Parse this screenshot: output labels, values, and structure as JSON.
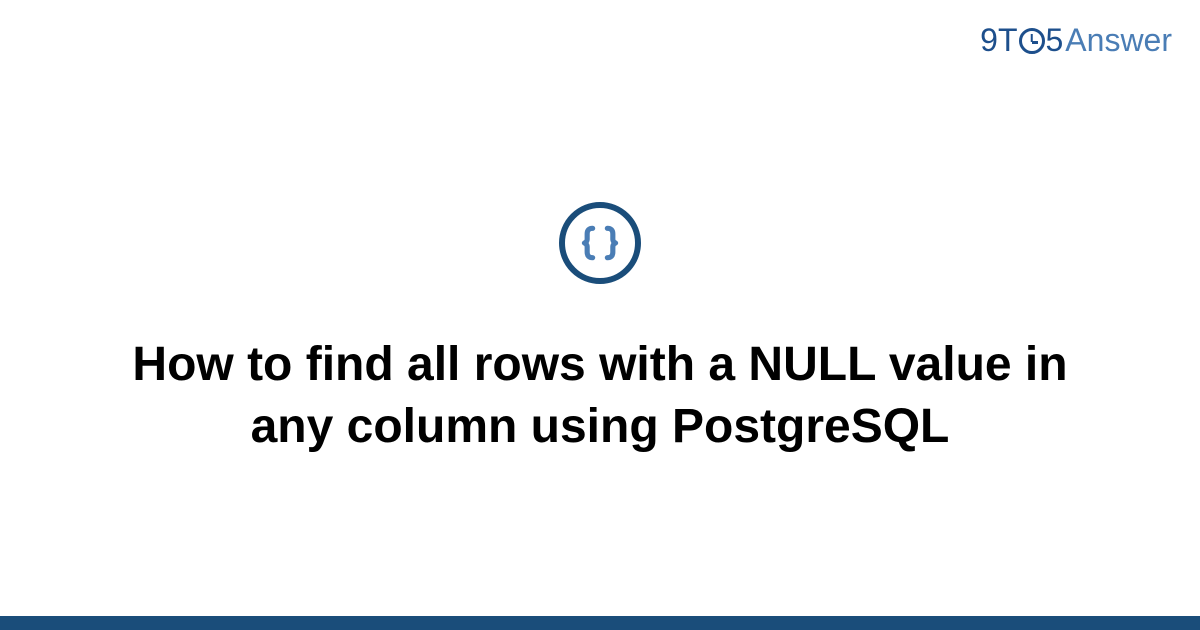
{
  "logo": {
    "part1": "9T",
    "part2": "5",
    "part3": "Answer"
  },
  "title": "How to find all rows with a NULL value in any column using PostgreSQL",
  "colors": {
    "primary": "#1a4d7a",
    "accent": "#4a7db5"
  }
}
